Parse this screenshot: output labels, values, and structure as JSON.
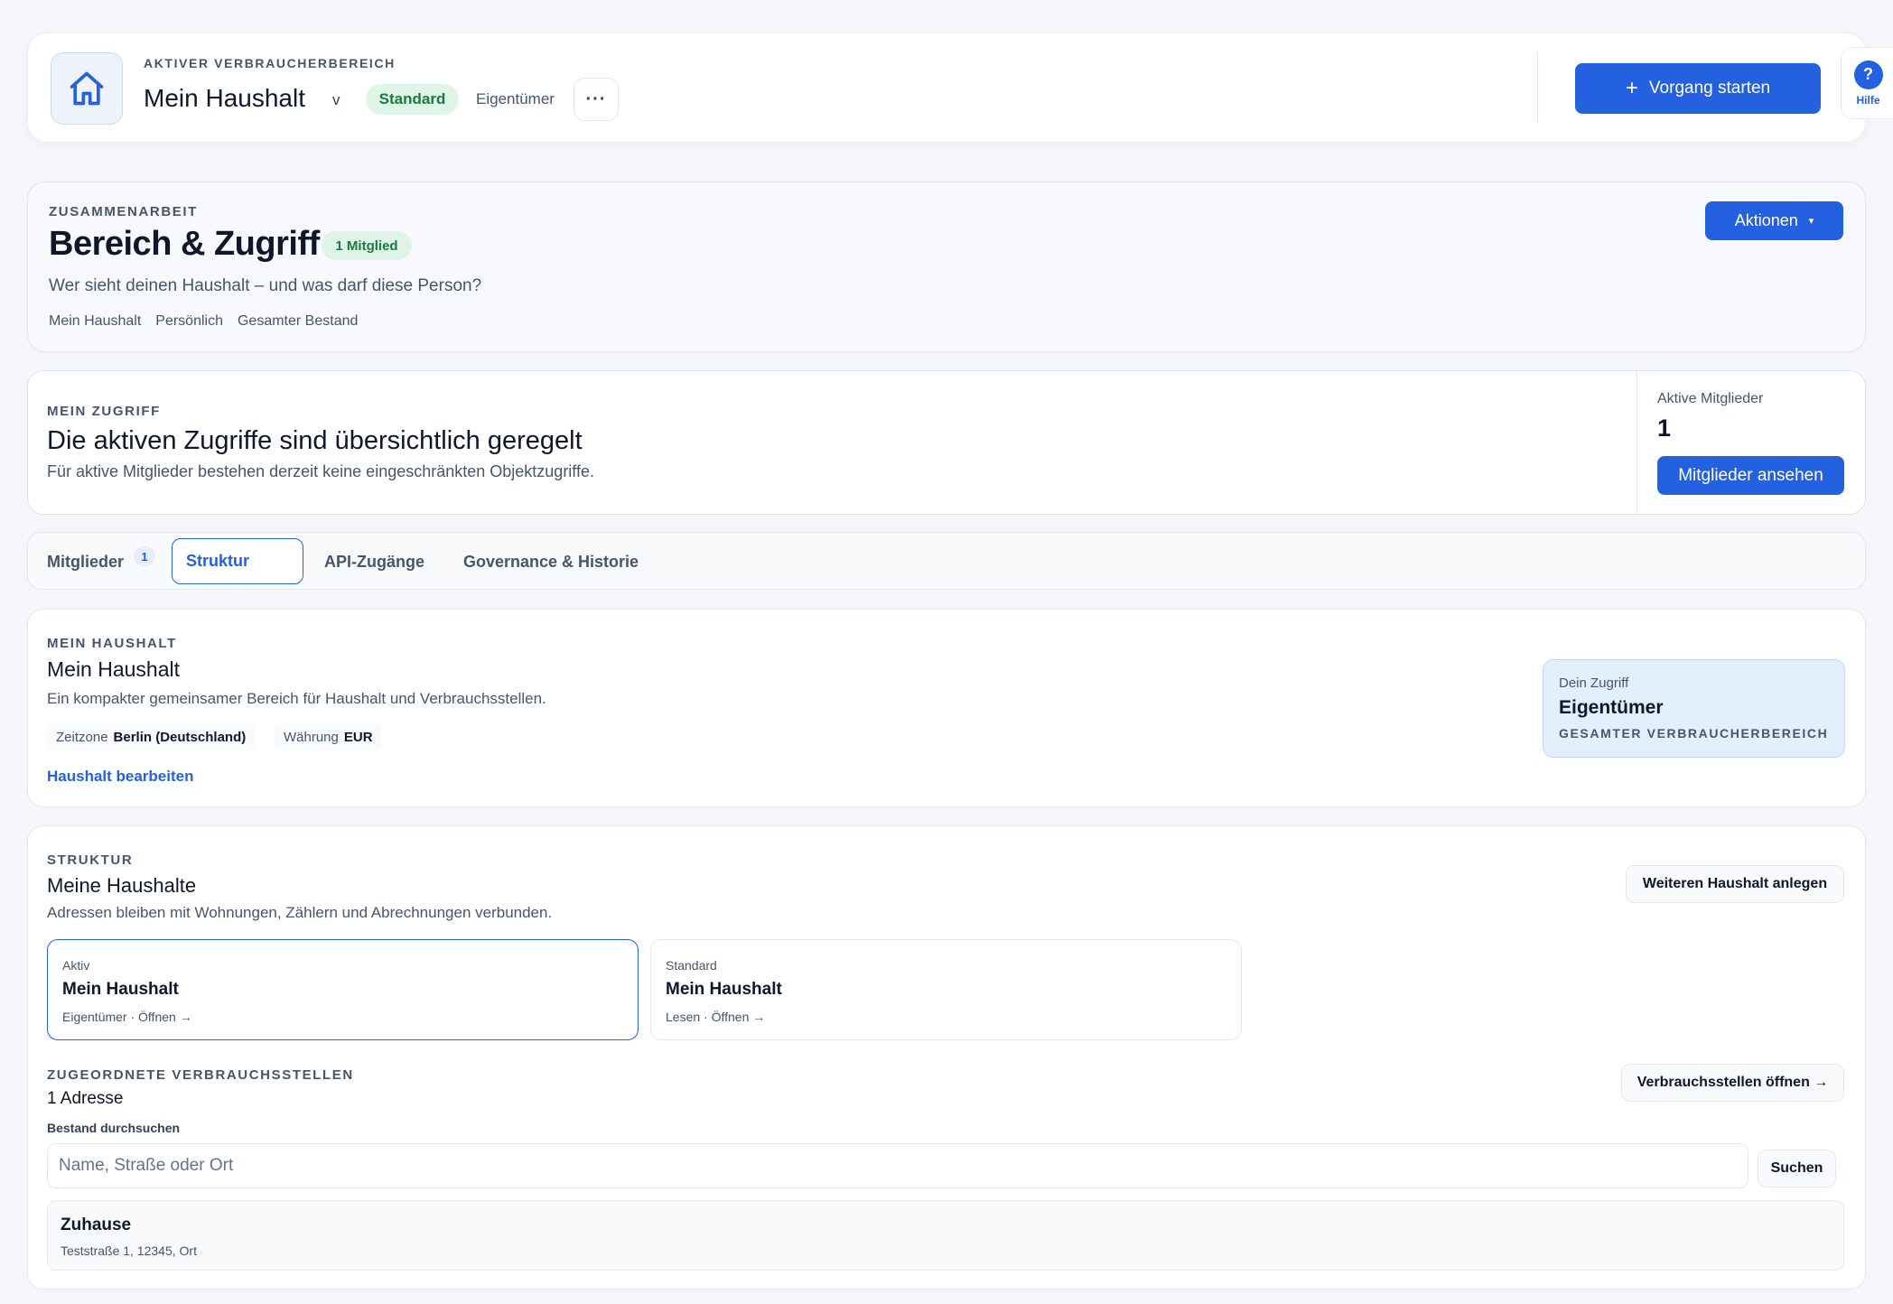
{
  "header": {
    "eyebrow": "AKTIVER VERBRAUCHERBEREICH",
    "household_name": "Mein Haushalt",
    "dropdown_glyph": "v",
    "badge": "Standard",
    "role": "Eigentümer",
    "more_glyph": "···",
    "start_button": "Vorgang starten",
    "start_icon": "+",
    "help_glyph": "?",
    "help_label": "Hilfe"
  },
  "collab": {
    "eyebrow": "ZUSAMMENARBEIT",
    "title": "Bereich & Zugriff",
    "member_badge": "1 Mitglied",
    "subtitle": "Wer sieht deinen Haushalt – und was darf diese Person?",
    "breadcrumbs": [
      "Mein Haushalt",
      "Persönlich",
      "Gesamter Bestand"
    ],
    "actions_button": "Aktionen",
    "actions_caret": "▾"
  },
  "access": {
    "eyebrow": "MEIN ZUGRIFF",
    "title": "Die aktiven Zugriffe sind übersichtlich geregelt",
    "text": "Für aktive Mitglieder bestehen derzeit keine eingeschränkten Objektzugriffe.",
    "members_label": "Aktive Mitglieder",
    "members_count": "1",
    "members_button": "Mitglieder ansehen"
  },
  "tabs": {
    "members": "Mitglieder",
    "members_count": "1",
    "structure": "Struktur",
    "api": "API-Zugänge",
    "governance": "Governance & Historie"
  },
  "household": {
    "eyebrow": "MEIN HAUSHALT",
    "title": "Mein Haushalt",
    "text": "Ein kompakter gemeinsamer Bereich für Haushalt und Verbrauchsstellen.",
    "timezone_label": "Zeitzone",
    "timezone_value": "Berlin (Deutschland)",
    "currency_label": "Währung",
    "currency_value": "EUR",
    "edit_link": "Haushalt bearbeiten",
    "access_label": "Dein Zugriff",
    "access_role": "Eigentümer",
    "access_scope": "GESAMTER VERBRAUCHERBEREICH"
  },
  "structure": {
    "eyebrow": "STRUKTUR",
    "title": "Meine Haushalte",
    "text": "Adressen bleiben mit Wohnungen, Zählern und Abrechnungen verbunden.",
    "add_button": "Weiteren Haushalt anlegen",
    "cards": [
      {
        "tag": "Aktiv",
        "name": "Mein Haushalt",
        "meta": "Eigentümer · Öffnen →"
      },
      {
        "tag": "Standard",
        "name": "Mein Haushalt",
        "meta": "Lesen · Öffnen →"
      }
    ],
    "points_eyebrow": "ZUGEORDNETE VERBRAUCHSSTELLEN",
    "points_count": "1 Adresse",
    "open_points_button": "Verbrauchsstellen öffnen →",
    "search_label": "Bestand durchsuchen",
    "search_placeholder": "Name, Straße oder Ort",
    "search_button": "Suchen",
    "address_name": "Zuhause",
    "address_line": "Teststraße 1, 12345, Ort"
  },
  "colors": {
    "accent": "#2461e0",
    "badge_green_bg": "#dff5e7",
    "badge_green_text": "#1a7a41",
    "access_tile_bg": "#e3effd"
  }
}
